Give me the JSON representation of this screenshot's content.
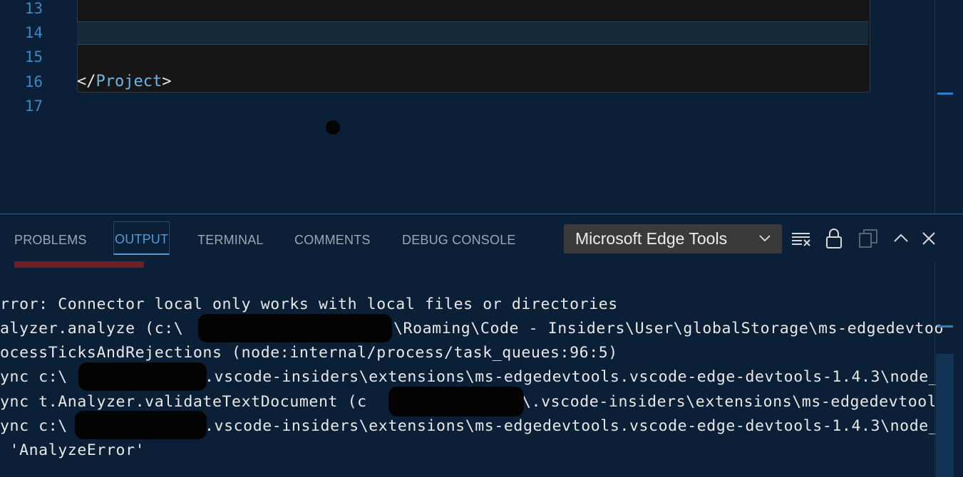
{
  "editor": {
    "line_numbers": [
      "13",
      "14",
      "15",
      "16",
      "17"
    ],
    "code": {
      "line16_open": "</",
      "line16_tag": "Project",
      "line16_close": ">"
    }
  },
  "panel": {
    "tabs": [
      {
        "label": "PROBLEMS"
      },
      {
        "label": "OUTPUT"
      },
      {
        "label": "TERMINAL"
      },
      {
        "label": "COMMENTS"
      },
      {
        "label": "DEBUG CONSOLE"
      }
    ],
    "active_tab": "OUTPUT",
    "channel_select": {
      "value": "Microsoft Edge Tools"
    },
    "toolbar_icons": [
      "clear-output-icon",
      "lock-scroll-icon",
      "copy-icon",
      "maximize-panel-icon",
      "close-panel-icon"
    ]
  },
  "output": {
    "lines": [
      "rror: Connector local only works with local files or directories",
      "alyzer.analyze (c:\\",
      "\\Roaming\\Code - Insiders\\User\\globalStorage\\ms-edgedevtoo",
      "ocessTicksAndRejections (node:internal/process/task_queues:96:5)",
      "ync c:\\",
      ".vscode-insiders\\extensions\\ms-edgedevtools.vscode-edge-devtools-1.4.3\\node_",
      "ync t.Analyzer.validateTextDocument (c",
      "\\.vscode-insiders\\extensions\\ms-edgedevtools",
      "ync c:\\",
      ".vscode-insiders\\extensions\\ms-edgedevtools.vscode-edge-devtools-1.4.3\\node_",
      " 'AnalyzeError'"
    ]
  },
  "colors": {
    "background": "#0b2036",
    "accent": "#4d9de0",
    "line_number": "#3c88c4",
    "select_bg": "#3a3a3a"
  }
}
